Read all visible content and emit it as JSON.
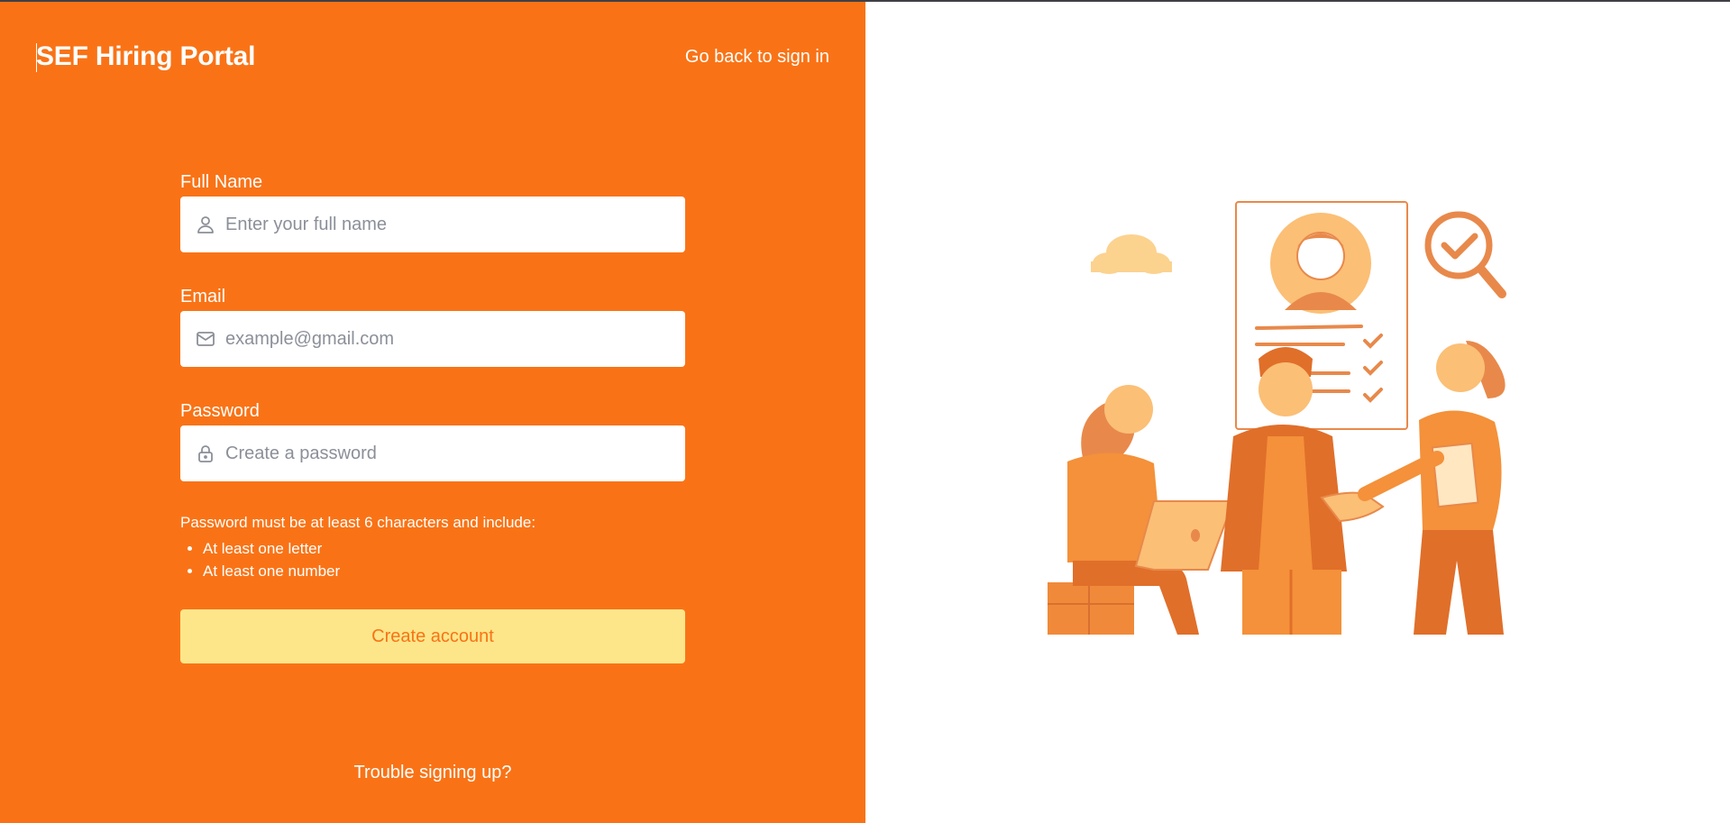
{
  "header": {
    "brand": "SEF Hiring Portal",
    "back_link": "Go back to sign in"
  },
  "form": {
    "full_name": {
      "label": "Full Name",
      "placeholder": "Enter your full name",
      "value": "",
      "icon": "user-icon"
    },
    "email": {
      "label": "Email",
      "placeholder": "example@gmail.com",
      "value": "",
      "icon": "mail-icon"
    },
    "password": {
      "label": "Password",
      "placeholder": "Create a password",
      "value": "",
      "icon": "lock-icon"
    },
    "rules": {
      "intro": "Password must be at least 6 characters and include:",
      "items": [
        "At least one letter",
        "At least one number"
      ]
    },
    "submit_label": "Create account"
  },
  "footer": {
    "trouble_link": "Trouble signing up?"
  },
  "theme": {
    "accent": "#f97316",
    "button_bg": "#fde68a",
    "illustration": "hiring-team-illustration"
  }
}
